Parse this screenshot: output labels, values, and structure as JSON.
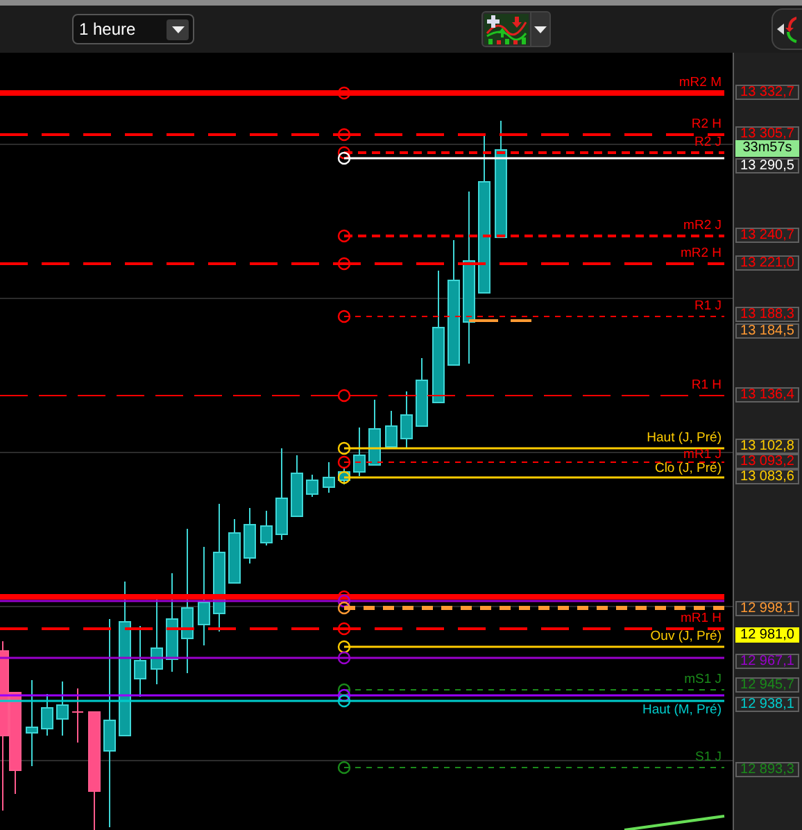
{
  "toolbar": {
    "timeframe": "1 heure"
  },
  "countdown": "33m57s",
  "levels": [
    {
      "label": "mR2 M",
      "price": "13 332,7",
      "color": "#ff0000",
      "kind": "thick",
      "highlighted": false
    },
    {
      "label": "R2 H",
      "price": "13 305,7",
      "color": "#ff0000",
      "kind": "longdash",
      "highlighted": false
    },
    {
      "label": "R2 J",
      "color": "#ff0000",
      "kind": "dot"
    },
    {
      "price": "13 290,5",
      "color": "#ffffff",
      "kind": "solid",
      "highlighted": false
    },
    {
      "label": "mR2 J",
      "price": "13 240,7",
      "color": "#ff0000",
      "kind": "dot",
      "highlighted": false
    },
    {
      "label": "mR2 H",
      "price": "13 221,0",
      "color": "#ff0000",
      "kind": "longdash",
      "highlighted": false
    },
    {
      "label": "R1 J",
      "price": "13 188,3",
      "color": "#ff0000",
      "kind": "finedash",
      "highlighted": false
    },
    {
      "price": "13 184,5",
      "color": "#ff9933",
      "kind": "segment",
      "highlighted": false
    },
    {
      "label": "R1 H",
      "price": "13 136,4",
      "color": "#ff0000",
      "kind": "dash",
      "highlighted": false
    },
    {
      "label": "Haut (J, Pré)",
      "price": "13 102,8",
      "color": "#ffcc00",
      "kind": "solid",
      "highlighted": false
    },
    {
      "label": "mR1 J",
      "price": "13 093,2",
      "color": "#ff0000",
      "kind": "finedash",
      "highlighted": false
    },
    {
      "label": "Clo (J, Pré)",
      "price": "13 083,6",
      "color": "#ffcc00",
      "kind": "solid",
      "highlighted": false
    },
    {
      "color": "#ff0000",
      "kind": "thick"
    },
    {
      "color": "#9900cc",
      "kind": "rule"
    },
    {
      "price": "12 998,1",
      "color": "#ff9933",
      "kind": "boldash",
      "highlighted": false
    },
    {
      "label": "mR1 H",
      "color": "#ff0000",
      "kind": "longdash"
    },
    {
      "label": "Ouv (J, Pré)",
      "price": "12 981,0",
      "color": "#ffcc00",
      "kind": "solid",
      "highlighted": true
    },
    {
      "price": "12 967,1",
      "color": "#9900cc",
      "kind": "rule",
      "highlighted": false
    },
    {
      "label": "mS1 J",
      "price": "12 945,7",
      "color": "#1a8a1a",
      "kind": "finedash",
      "highlighted": false
    },
    {
      "color": "#9900ff",
      "kind": "rule"
    },
    {
      "label": "Haut (M, Pré)",
      "price": "12 938,1",
      "color": "#00cccc",
      "kind": "rule",
      "highlighted": false
    },
    {
      "label": "S1 J",
      "price": "12 893,3",
      "color": "#1a8a1a",
      "kind": "finedash",
      "highlighted": false
    }
  ]
}
